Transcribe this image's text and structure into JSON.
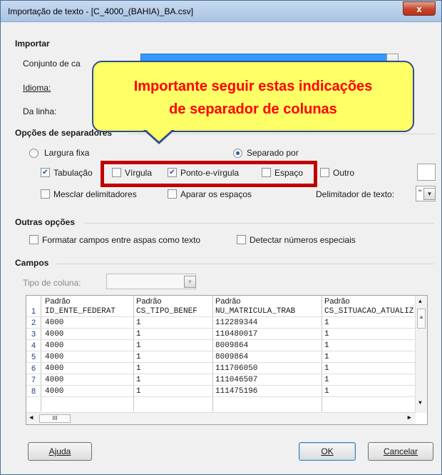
{
  "window": {
    "title": "Importação de texto - [C_4000_(BAHIA)_BA.csv]",
    "close_glyph": "x"
  },
  "import": {
    "section": "Importar",
    "charset_label": "Conjunto de ca",
    "language_label": "Idioma:",
    "from_row_label": "Da linha:"
  },
  "callout": {
    "line1": "Importante seguir estas indicações",
    "line2": "de separador de colunas",
    "bg_color": "#ffff66",
    "text_color": "#ff0000"
  },
  "separators": {
    "section": "Opções de separadores",
    "fixed_width": "Largura fixa",
    "separated_by": "Separado por",
    "tab": "Tabulação",
    "comma": "Vírgula",
    "semicolon": "Ponto-e-vírgula",
    "space": "Espaço",
    "other": "Outro",
    "merge": "Mesclar delimitadores",
    "trim": "Aparar os espaços",
    "text_delimiter_label": "Delimitador de texto:",
    "text_delimiter_value": "\""
  },
  "other_options": {
    "section": "Outras opções",
    "quoted_as_text": "Formatar campos entre aspas como texto",
    "detect_special": "Detectar números especiais"
  },
  "fields": {
    "section": "Campos",
    "column_type_label": "Tipo de coluna:",
    "headers": [
      "Padrão",
      "Padrão",
      "Padrão",
      "Padrão"
    ],
    "rows": [
      [
        "1",
        "ID_ENTE_FEDERAT",
        "CS_TIPO_BENEF",
        "NU_MATRICULA_TRAB",
        "CS_SITUACAO_ATUALIZ"
      ],
      [
        "2",
        "4000",
        "1",
        "112289344",
        "1"
      ],
      [
        "3",
        "4000",
        "1",
        "110480017",
        "1"
      ],
      [
        "4",
        "4000",
        "1",
        "8009864",
        "1"
      ],
      [
        "5",
        "4000",
        "1",
        "8009864",
        "1"
      ],
      [
        "6",
        "4000",
        "1",
        "111706050",
        "1"
      ],
      [
        "7",
        "4000",
        "1",
        "111046507",
        "1"
      ],
      [
        "8",
        "4000",
        "1",
        "111475196",
        "1"
      ]
    ],
    "scroll_thumb": "III"
  },
  "buttons": {
    "help": "Ajuda",
    "ok": "OK",
    "cancel": "Cancelar"
  }
}
